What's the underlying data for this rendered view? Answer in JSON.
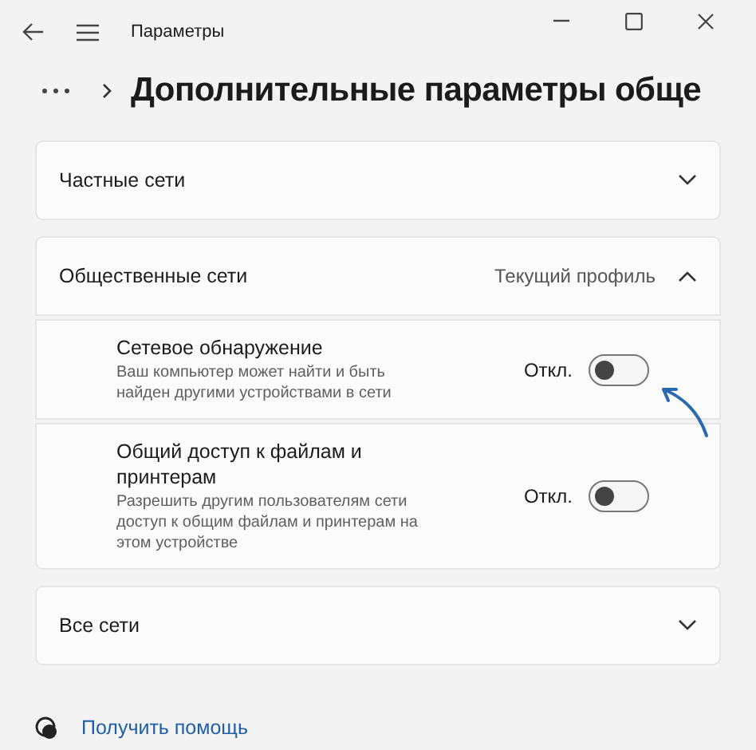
{
  "window": {
    "title": "Параметры"
  },
  "heading": "Дополнительные параметры обще",
  "sections": [
    {
      "label": "Частные сети",
      "expanded": false
    },
    {
      "label": "Общественные сети",
      "status": "Текущий профиль",
      "expanded": true,
      "settings": [
        {
          "title": "Сетевое обнаружение",
          "description": "Ваш компьютер может найти и быть найден другими устройствами в сети",
          "state": "Откл.",
          "on": false
        },
        {
          "title": "Общий доступ к файлам и принтерам",
          "description": "Разрешить другим пользователям сети доступ к общим файлам и принтерам на этом устройстве",
          "state": "Откл.",
          "on": false
        }
      ]
    },
    {
      "label": "Все сети",
      "expanded": false
    }
  ],
  "help_link": "Получить помощь"
}
